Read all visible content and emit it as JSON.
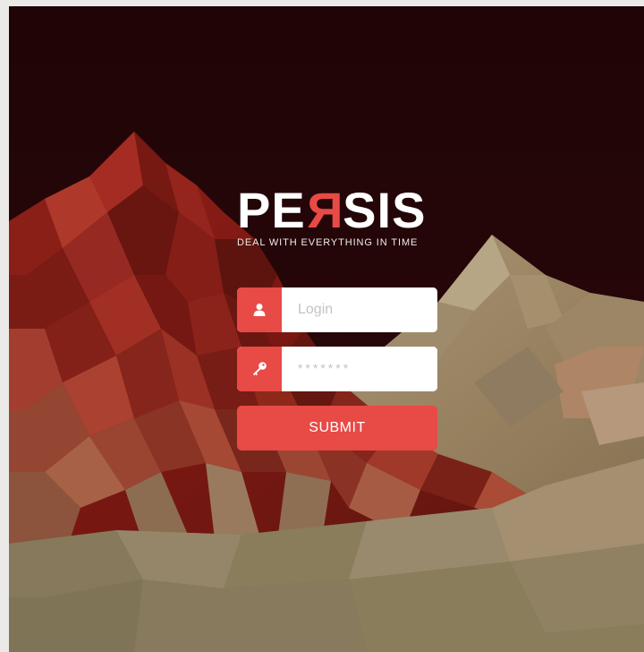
{
  "brand": {
    "logo_left": "PE",
    "logo_accent": "R",
    "logo_right": "SIS",
    "tagline": "DEAL WITH EVERYTHING IN TIME",
    "accent_color": "#e84a45"
  },
  "login": {
    "placeholder": "Login",
    "icon": "user-icon"
  },
  "password": {
    "placeholder": "*******",
    "icon": "key-icon"
  },
  "submit": {
    "label": "SUBMIT"
  }
}
